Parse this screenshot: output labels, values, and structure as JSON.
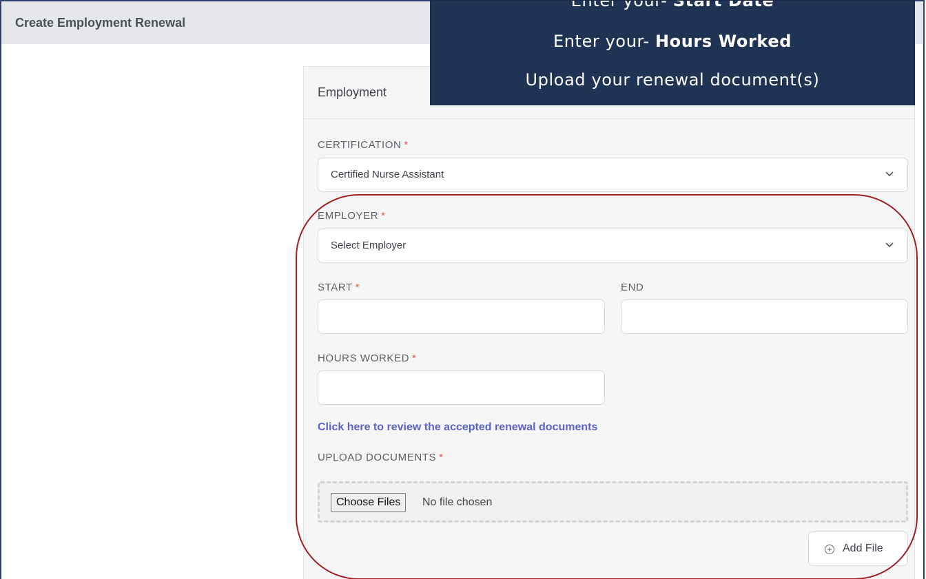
{
  "page": {
    "title": "Create Employment Renewal"
  },
  "callout": {
    "line1_prefix": "Enter your- ",
    "line1_bold": "Start Date",
    "line2_prefix": "Enter your- ",
    "line2_bold": "Hours Worked",
    "line3": "Upload your renewal document(s)",
    "color": "#1f3354"
  },
  "card": {
    "title": "Employment"
  },
  "form": {
    "required_mark": "*",
    "certification": {
      "label": "CERTIFICATION",
      "value": "Certified Nurse Assistant"
    },
    "employer": {
      "label": "EMPLOYER",
      "value": "Select Employer"
    },
    "start": {
      "label": "START",
      "value": ""
    },
    "end": {
      "label": "END",
      "value": ""
    },
    "hours_worked": {
      "label": "HOURS WORKED",
      "value": ""
    },
    "review_link": "Click here to review the accepted renewal documents",
    "upload": {
      "label": "UPLOAD DOCUMENTS",
      "choose_label": "Choose Files",
      "status": "No file chosen"
    },
    "add_file_label": "Add File"
  },
  "colors": {
    "required": "#e25656",
    "link": "#5a63c7",
    "highlight": "#a11d26"
  },
  "icons": {
    "select_arrow": "chevron-down-icon",
    "add_file": "plus-circle-icon"
  }
}
